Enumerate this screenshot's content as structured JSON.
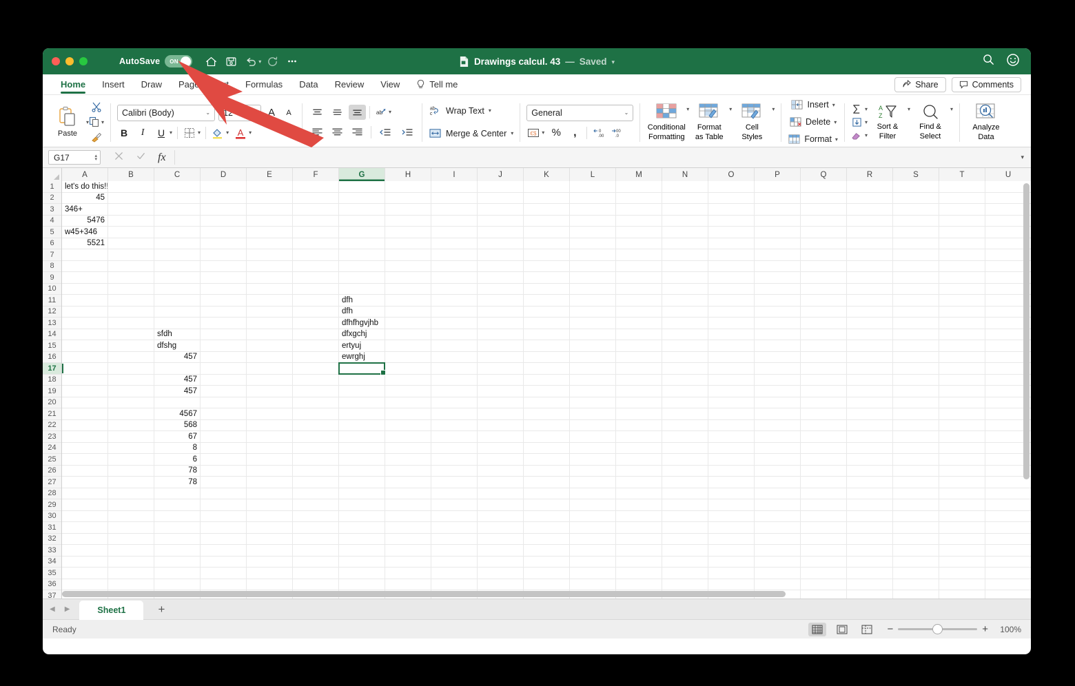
{
  "window": {
    "title": "Drawings calcul. 43",
    "separator": "—",
    "saved_state": "Saved",
    "autosave_label": "AutoSave",
    "autosave_value": "ON"
  },
  "titlebar": {
    "icons": [
      "home-icon",
      "save-icon",
      "undo-icon",
      "redo-icon",
      "more-icon",
      "search-icon",
      "smiley-icon"
    ]
  },
  "tabs": [
    {
      "label": "Home",
      "active": true
    },
    {
      "label": "Insert",
      "active": false
    },
    {
      "label": "Draw",
      "active": false
    },
    {
      "label": "Page Layout",
      "active": false
    },
    {
      "label": "Formulas",
      "active": false
    },
    {
      "label": "Data",
      "active": false
    },
    {
      "label": "Review",
      "active": false
    },
    {
      "label": "View",
      "active": false
    }
  ],
  "tellme": {
    "label": "Tell me"
  },
  "header_buttons": {
    "share": "Share",
    "comments": "Comments"
  },
  "ribbon": {
    "clipboard": {
      "paste": "Paste"
    },
    "font": {
      "name": "Calibri (Body)",
      "size": "12",
      "bold": "B",
      "italic": "I",
      "underline": "U"
    },
    "alignment": {
      "wrap_text": "Wrap Text",
      "merge_center": "Merge & Center"
    },
    "number": {
      "format": "General",
      "percent": "%",
      "comma": ","
    },
    "styles": {
      "conditional_formatting": "Conditional\nFormatting",
      "conditional_formatting_l1": "Conditional",
      "conditional_formatting_l2": "Formatting",
      "format_as_table_l1": "Format",
      "format_as_table_l2": "as Table",
      "cell_styles_l1": "Cell",
      "cell_styles_l2": "Styles"
    },
    "cells": {
      "insert": "Insert",
      "delete": "Delete",
      "format": "Format"
    },
    "editing": {
      "sort_filter_l1": "Sort &",
      "sort_filter_l2": "Filter",
      "find_select_l1": "Find &",
      "find_select_l2": "Select"
    },
    "analysis": {
      "analyze_data_l1": "Analyze",
      "analyze_data_l2": "Data"
    }
  },
  "formula_bar": {
    "name_box": "G17",
    "formula_value": "",
    "cancel_icon": "close-icon",
    "confirm_icon": "check-icon",
    "function_icon": "fx-icon"
  },
  "grid": {
    "columns": [
      "A",
      "B",
      "C",
      "D",
      "E",
      "F",
      "G",
      "H",
      "I",
      "J",
      "K",
      "L",
      "M",
      "N",
      "O",
      "P",
      "Q",
      "R",
      "S",
      "T",
      "U"
    ],
    "selected_column": "G",
    "selected_row": 17,
    "selected_cell": "G17",
    "rows": [
      1,
      2,
      3,
      4,
      5,
      6,
      7,
      8,
      9,
      10,
      11,
      12,
      13,
      14,
      15,
      16,
      17,
      18,
      19,
      20,
      21,
      22,
      23,
      24,
      25,
      26,
      27,
      28,
      29,
      30,
      31,
      32,
      33,
      34,
      35,
      36,
      37
    ],
    "cells": [
      {
        "row": 1,
        "col": 0,
        "value": "let's do this!!",
        "type": "text"
      },
      {
        "row": 2,
        "col": 0,
        "value": "45",
        "type": "number"
      },
      {
        "row": 3,
        "col": 0,
        "value": "346+",
        "type": "text"
      },
      {
        "row": 4,
        "col": 0,
        "value": "5476",
        "type": "number"
      },
      {
        "row": 5,
        "col": 0,
        "value": "w45+346",
        "type": "text"
      },
      {
        "row": 6,
        "col": 0,
        "value": "5521",
        "type": "number"
      },
      {
        "row": 11,
        "col": 6,
        "value": "dfh",
        "type": "text"
      },
      {
        "row": 12,
        "col": 6,
        "value": "dfh",
        "type": "text"
      },
      {
        "row": 13,
        "col": 6,
        "value": "dfhfhgvjhb",
        "type": "text"
      },
      {
        "row": 14,
        "col": 6,
        "value": "dfxgchj",
        "type": "text"
      },
      {
        "row": 15,
        "col": 6,
        "value": "ertyuj",
        "type": "text"
      },
      {
        "row": 16,
        "col": 6,
        "value": "ewrghj",
        "type": "text"
      },
      {
        "row": 14,
        "col": 2,
        "value": "sfdh",
        "type": "text"
      },
      {
        "row": 15,
        "col": 2,
        "value": "dfshg",
        "type": "text"
      },
      {
        "row": 16,
        "col": 2,
        "value": "457",
        "type": "number"
      },
      {
        "row": 18,
        "col": 2,
        "value": "457",
        "type": "number"
      },
      {
        "row": 19,
        "col": 2,
        "value": "457",
        "type": "number"
      },
      {
        "row": 21,
        "col": 2,
        "value": "4567",
        "type": "number"
      },
      {
        "row": 22,
        "col": 2,
        "value": "568",
        "type": "number"
      },
      {
        "row": 23,
        "col": 2,
        "value": "67",
        "type": "number"
      },
      {
        "row": 24,
        "col": 2,
        "value": "8",
        "type": "number"
      },
      {
        "row": 25,
        "col": 2,
        "value": "6",
        "type": "number"
      },
      {
        "row": 26,
        "col": 2,
        "value": "78",
        "type": "number"
      },
      {
        "row": 27,
        "col": 2,
        "value": "78",
        "type": "number"
      }
    ]
  },
  "sheet_tabs": {
    "sheets": [
      "Sheet1"
    ],
    "active": "Sheet1",
    "add_label": "+"
  },
  "status_bar": {
    "status": "Ready",
    "zoom": "100%",
    "views": [
      "normal-view-icon",
      "page-layout-icon",
      "page-break-icon"
    ]
  },
  "annotation": {
    "type": "arrow",
    "color": "#e04a42",
    "points_to": "autosave-toggle"
  },
  "colors": {
    "brand_green": "#1e7145",
    "selection_green": "#d9eadd",
    "annotation_red": "#e04a42"
  }
}
